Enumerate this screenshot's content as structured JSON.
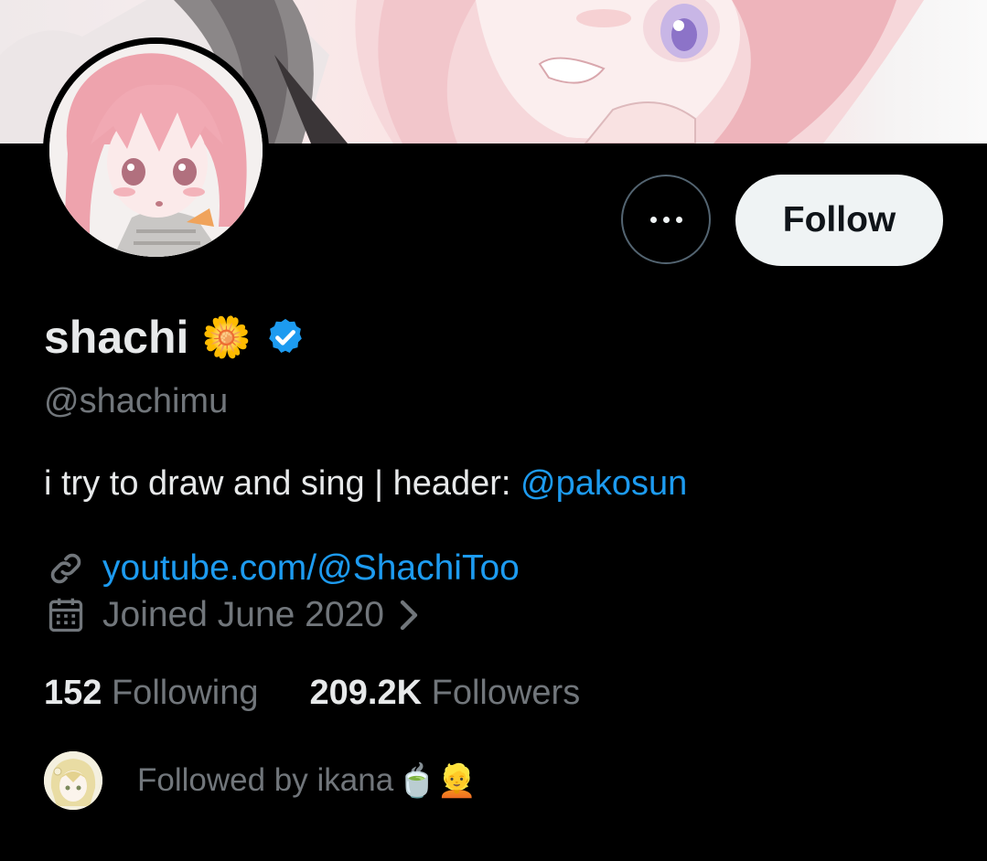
{
  "profile": {
    "display_name": "shachi",
    "name_emoji": "🌼",
    "handle": "@shachimu",
    "bio_text": "i try to draw and sing | header: ",
    "bio_mention": "@pakosun",
    "website": "youtube.com/@ShachiToo",
    "joined": "Joined June 2020",
    "verified": true
  },
  "actions": {
    "follow_label": "Follow"
  },
  "stats": {
    "following_count": "152",
    "following_label": "Following",
    "followers_count": "209.2K",
    "followers_label": "Followers"
  },
  "followed_by": {
    "text": "Followed by ikana ",
    "emojis": "🍵👱"
  },
  "colors": {
    "background": "#000000",
    "accent": "#1d9bf0",
    "secondary_text": "#71767b",
    "primary_text": "#e7e9ea",
    "follow_button_bg": "#eff3f4"
  }
}
